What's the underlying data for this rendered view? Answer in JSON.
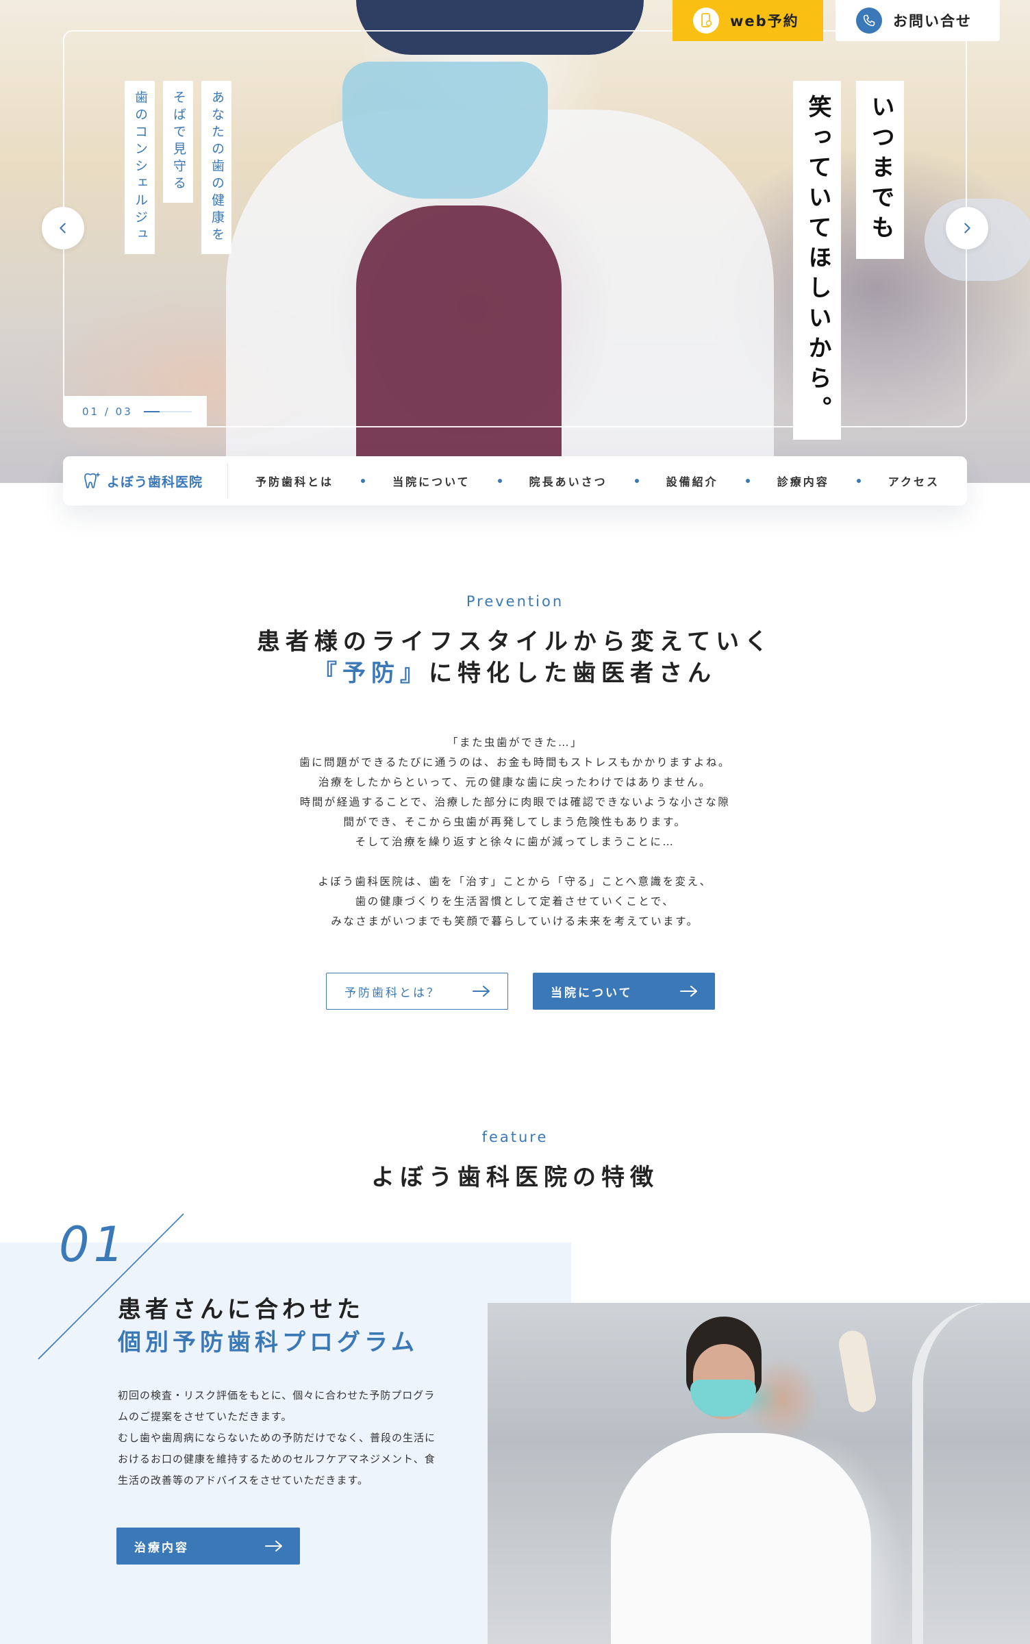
{
  "header": {
    "web_reserve_label": "web予約",
    "contact_label": "お問い合せ"
  },
  "hero": {
    "tagline_small": [
      "あなたの歯の健康を",
      "そばで見守る",
      "歯のコンシェルジュ"
    ],
    "tagline_big": [
      "いつまでも",
      "笑っていてほしいから。"
    ],
    "slide_counter": "01 / 03",
    "slide_progress": 0.333
  },
  "nav": {
    "logo_text": "よぼう歯科医院",
    "items": [
      "予防歯科とは",
      "当院について",
      "院長あいさつ",
      "設備紹介",
      "診療内容",
      "アクセス"
    ]
  },
  "prevention": {
    "label": "Prevention",
    "title_line1": "患者様のライフスタイルから変えていく",
    "title_accent": "『予防』",
    "title_line2_rest": "に特化した歯医者さん",
    "paragraph1": [
      "「また虫歯ができた…」",
      "歯に問題ができるたびに通うのは、お金も時間もストレスもかかりますよね。",
      "治療をしたからといって、元の健康な歯に戻ったわけではありません。",
      "時間が経過することで、治療した部分に肉眼では確認できないような小さな隙",
      "間ができ、そこから虫歯が再発してしまう危険性もあります。",
      "そして治療を繰り返すと徐々に歯が減ってしまうことに…"
    ],
    "paragraph2": [
      "よぼう歯科医院は、歯を「治す」ことから「守る」ことへ意識を変え、",
      "歯の健康づくりを生活習慣として定着させていくことで、",
      "みなさまがいつまでも笑顔で暮らしていける未来を考えています。"
    ],
    "btn_about_prevention": "予防歯科とは？",
    "btn_about_clinic": "当院について"
  },
  "feature": {
    "label": "feature",
    "title": "よぼう歯科医院の特徴",
    "items": [
      {
        "number": "01",
        "heading_line1": "患者さんに合わせた",
        "heading_line2": "個別予防歯科プログラム",
        "body": [
          "初回の検査・リスク評価をもとに、個々に合わせた予防プログラ",
          "ムのご提案をさせていただきます。",
          "むし歯や歯周病にならないための予防だけでなく、普段の生活に",
          "おけるお口の健康を維持するためのセルフケアマネジメント、食",
          "生活の改善等のアドバイスをさせていただきます。"
        ],
        "button_label": "治療内容"
      }
    ]
  },
  "colors": {
    "accent": "#3a78b8",
    "reserve_yellow": "#f9bf13",
    "feature_bg": "#edf4fc"
  }
}
